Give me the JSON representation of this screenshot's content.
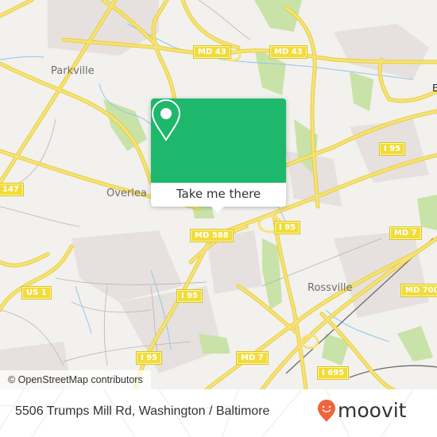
{
  "map": {
    "places": [
      {
        "name": "Parkville"
      },
      {
        "name": "Overlea"
      },
      {
        "name": "Rossville"
      }
    ],
    "shields": {
      "md43_a": "MD 43",
      "md43_b": "MD 43",
      "i95_ne": "I 95",
      "i95_center": "I 95",
      "md588": "MD 588",
      "md7_east": "MD 7",
      "us1": "US 1",
      "i95_sw": "I 95",
      "md700": "MD 700",
      "i95_south": "I 95",
      "md7_south": "MD 7",
      "i695": "I 695",
      "route147": "147"
    },
    "attribution": "© OpenStreetMap contributors",
    "colors": {
      "background": "#f2f1ee",
      "road": "#f6e27a",
      "road_casing": "#e8cf3a",
      "park": "#c9e2a8",
      "urban": "#e6e1de",
      "water": "#8ec8ea",
      "minor_road": "#b8b4b0",
      "rail": "#6b6b6b"
    }
  },
  "popup": {
    "button_label": "Take me there",
    "icon": "map-pin-icon",
    "color": "#1db86b"
  },
  "footer": {
    "address": "5506 Trumps Mill Rd, Washington / Baltimore",
    "brand": "moovit",
    "brand_color": "#f0643c"
  }
}
